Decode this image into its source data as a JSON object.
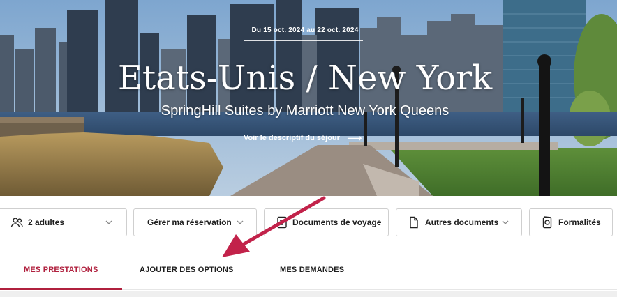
{
  "hero": {
    "dates": "Du 15 oct. 2024 au 22 oct. 2024",
    "destination": "Etats-Unis / New York",
    "hotel": "SpringHill Suites by Marriott New York Queens",
    "description_link": "Voir le descriptif du séjour",
    "description_arrow": "⟶"
  },
  "toolbar": {
    "travelers": {
      "label": "2 adultes",
      "icon": "users-icon"
    },
    "manage": {
      "label": "Gérer ma réservation"
    },
    "travel_docs": {
      "label": "Documents de voyage",
      "icon": "document-icon"
    },
    "other_docs": {
      "label": "Autres documents",
      "icon": "file-icon"
    },
    "formalities": {
      "label": "Formalités",
      "icon": "passport-icon"
    }
  },
  "tabs": [
    {
      "label": "MES PRESTATIONS",
      "active": true
    },
    {
      "label": "AJOUTER DES OPTIONS",
      "active": false
    },
    {
      "label": "MES DEMANDES",
      "active": false
    }
  ],
  "colors": {
    "accent": "#b0203e",
    "annotation_arrow": "#c2224a"
  }
}
